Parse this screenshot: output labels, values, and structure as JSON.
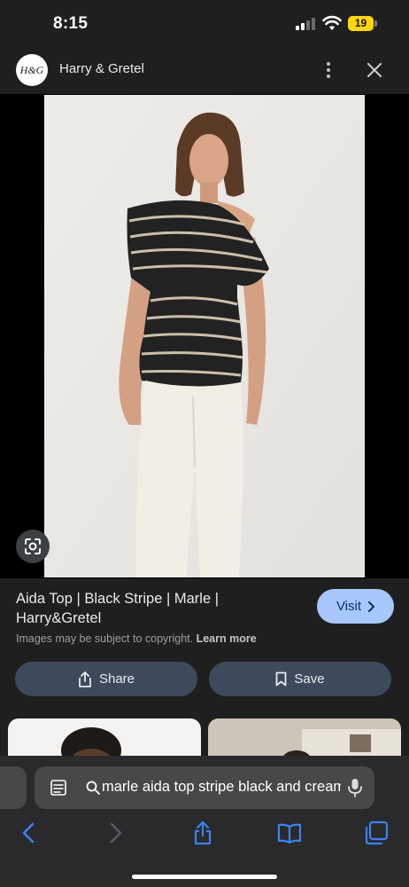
{
  "status_bar": {
    "time": "8:15",
    "battery_level": "19",
    "icons": [
      "cellular-signal-icon",
      "wifi-icon",
      "battery-icon"
    ]
  },
  "header": {
    "site_logo_text": "H&G",
    "site_name": "Harry & Gretel",
    "icons": [
      "more-vert-icon",
      "close-icon"
    ]
  },
  "image": {
    "lens_icon": "google-lens-icon"
  },
  "result": {
    "title": "Aida Top | Black Stripe | Marle | Harry&Gretel",
    "visit_label": "Visit",
    "copyright_text": "Images may be subject to copyright.",
    "learn_more_label": "Learn more",
    "share_label": "Share",
    "save_label": "Save",
    "accent_color": "#a8c7fa",
    "button_color": "#3c4a5c"
  },
  "browser": {
    "address_text": "marle aida top stripe black and cream",
    "toolbar_icons": [
      "back-icon",
      "forward-icon",
      "share-icon",
      "bookmarks-icon",
      "tabs-icon"
    ]
  }
}
